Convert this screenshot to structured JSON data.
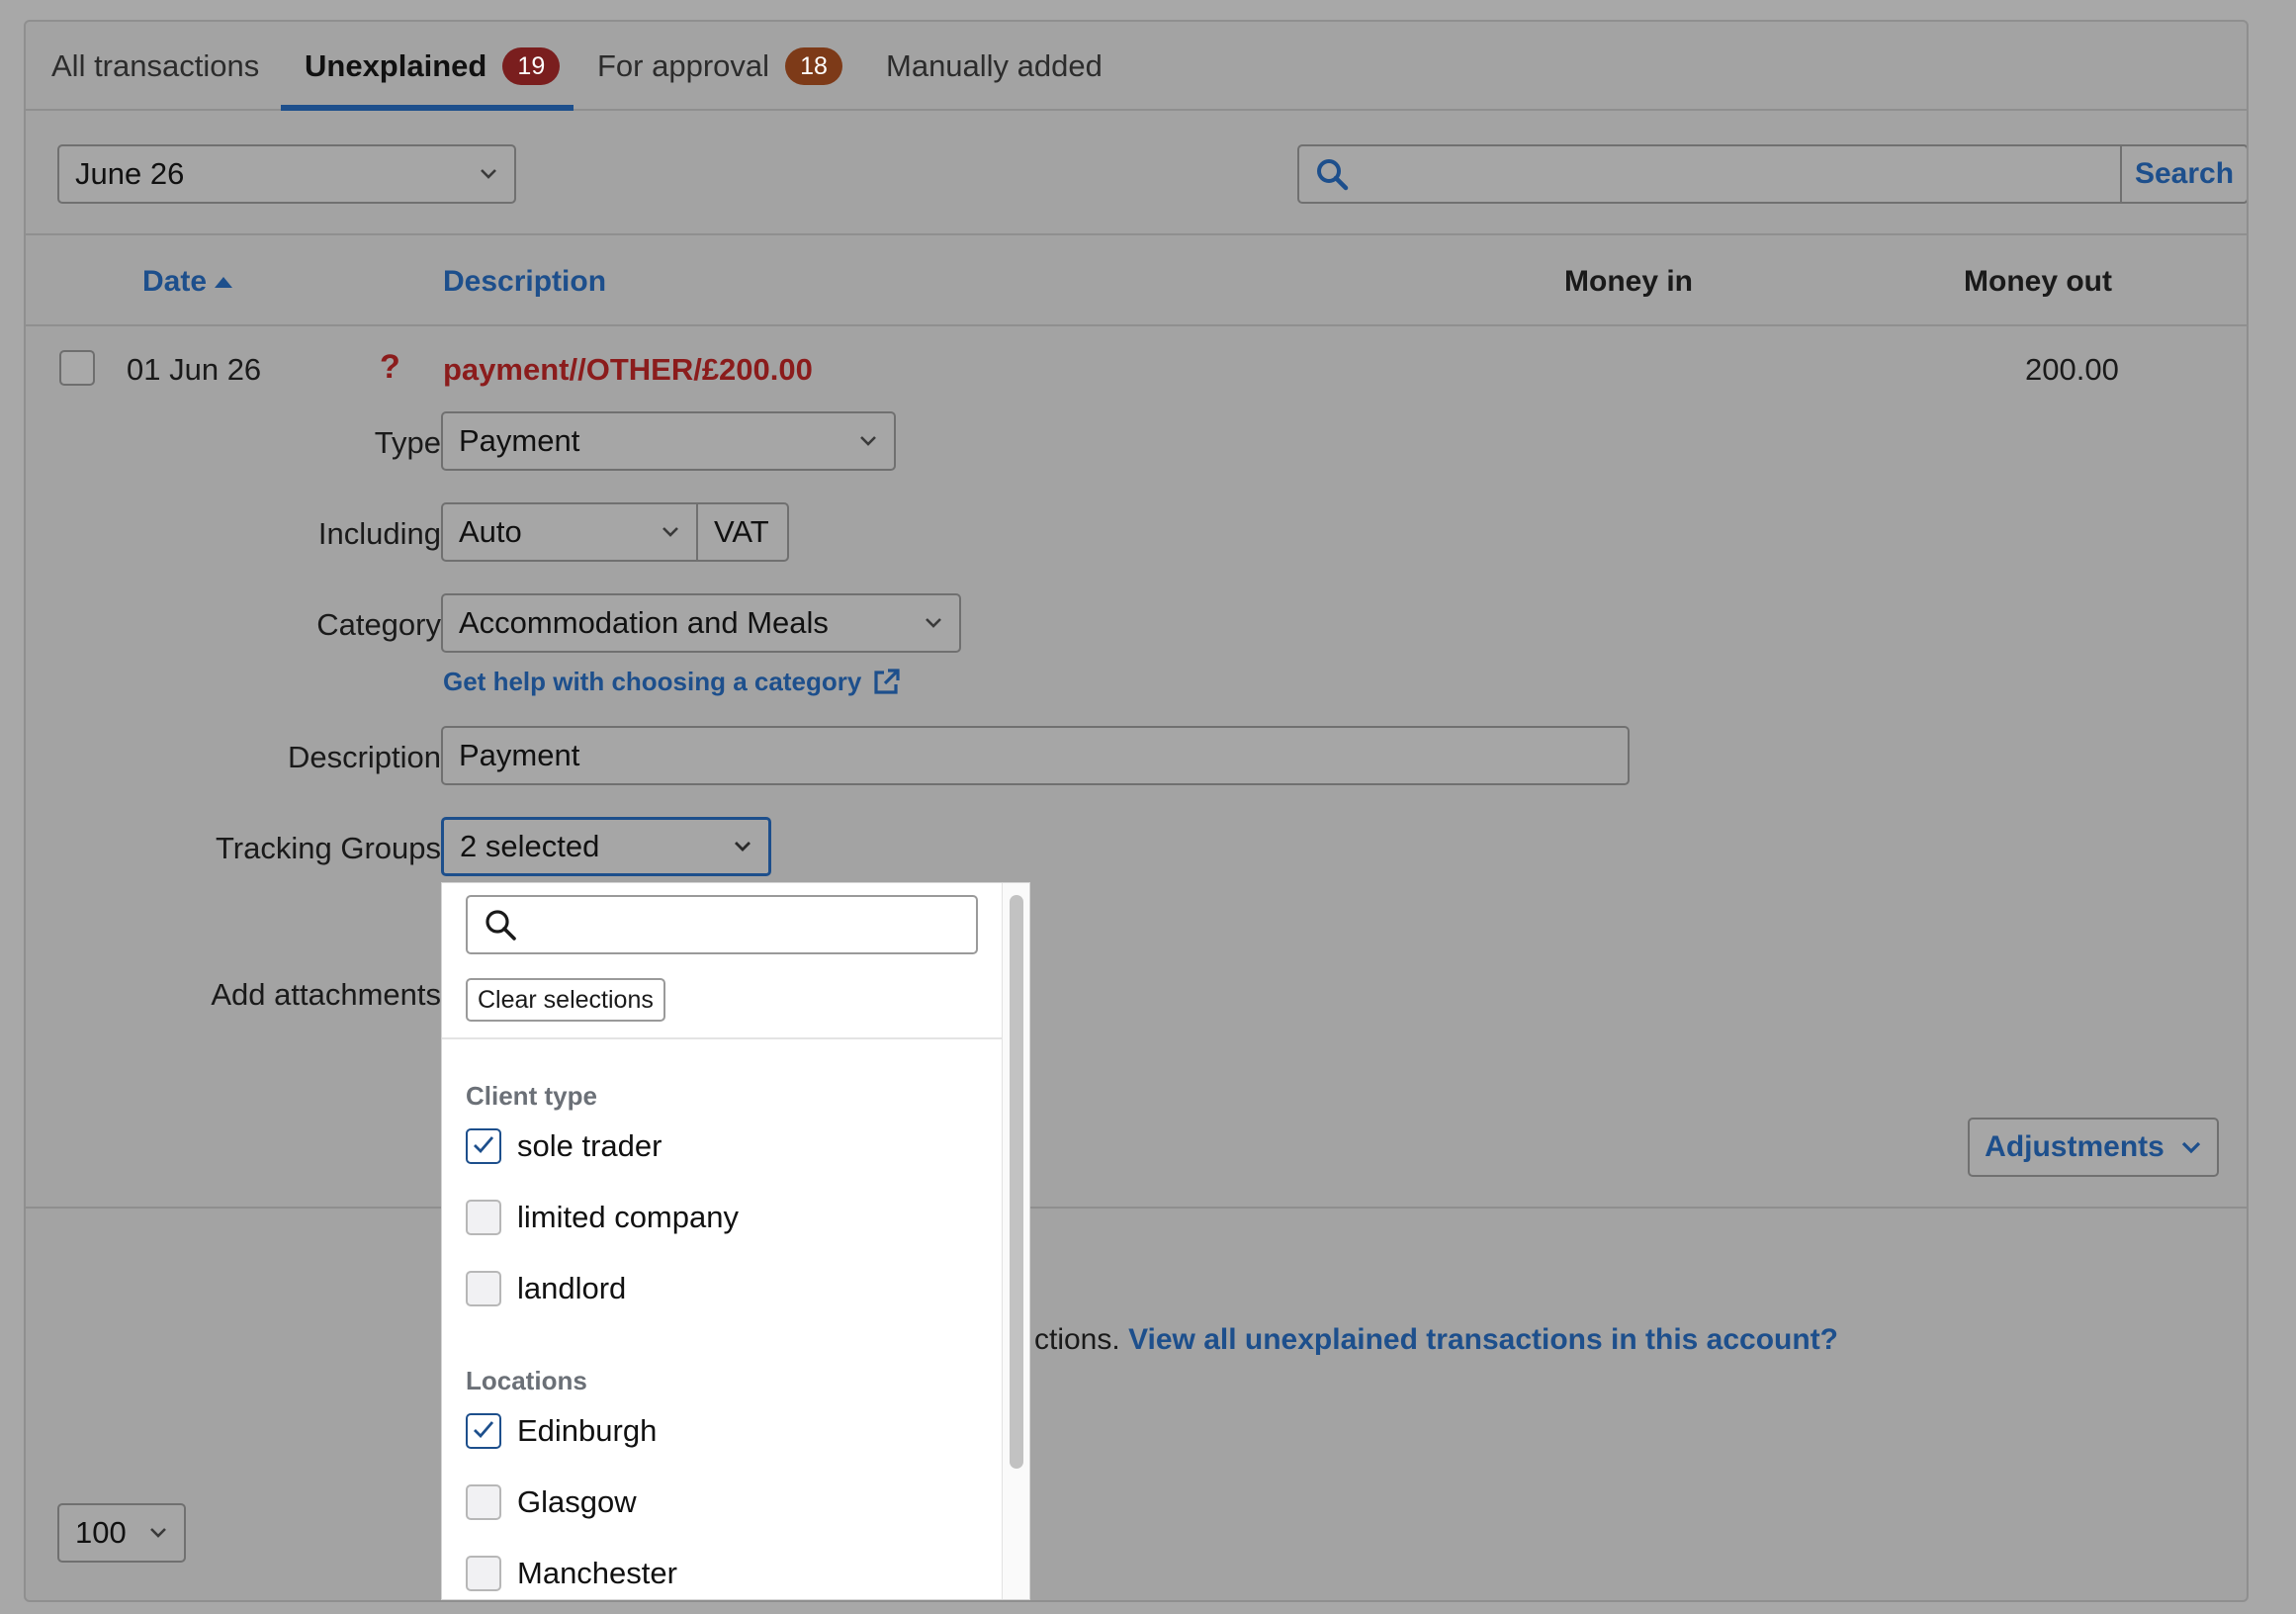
{
  "tabs": [
    {
      "label": "All transactions"
    },
    {
      "label": "Unexplained",
      "badge": "19"
    },
    {
      "label": "For approval",
      "badge": "18"
    },
    {
      "label": "Manually added"
    }
  ],
  "toolbar": {
    "period_select": "June 26",
    "search_placeholder": "",
    "search_button": "Search"
  },
  "table": {
    "headers": {
      "date": "Date",
      "description": "Description",
      "money_in": "Money in",
      "money_out": "Money out"
    }
  },
  "transaction": {
    "date": "01 Jun 26",
    "status_icon": "?",
    "description": "payment//OTHER/£200.00",
    "money_out": "200.00",
    "form": {
      "type_label": "Type",
      "type_value": "Payment",
      "including_label": "Including",
      "including_value": "Auto",
      "vat_label": "VAT",
      "category_label": "Category",
      "category_value": "Accommodation and Meals",
      "category_help": "Get help with choosing a category",
      "description_label": "Description",
      "description_value": "Payment",
      "tracking_label": "Tracking Groups",
      "tracking_value": "2 selected",
      "attachments_label": "Add attachments"
    },
    "adjustments_button": "Adjustments"
  },
  "footer": {
    "message_fragment": "ctions.",
    "view_all_link": "View all unexplained transactions in this account?",
    "page_size": "100"
  },
  "tracking_dropdown": {
    "search_placeholder": "",
    "clear_button": "Clear selections",
    "groups": [
      {
        "name": "Client type",
        "options": [
          {
            "label": "sole trader",
            "checked": true
          },
          {
            "label": "limited company",
            "checked": false
          },
          {
            "label": "landlord",
            "checked": false
          }
        ]
      },
      {
        "name": "Locations",
        "options": [
          {
            "label": "Edinburgh",
            "checked": true
          },
          {
            "label": "Glasgow",
            "checked": false
          },
          {
            "label": "Manchester",
            "checked": false
          }
        ]
      }
    ]
  },
  "colors": {
    "accent": "#1d4f8c",
    "error_text": "#8b1c1c",
    "overlay": "#a3a3a3"
  }
}
